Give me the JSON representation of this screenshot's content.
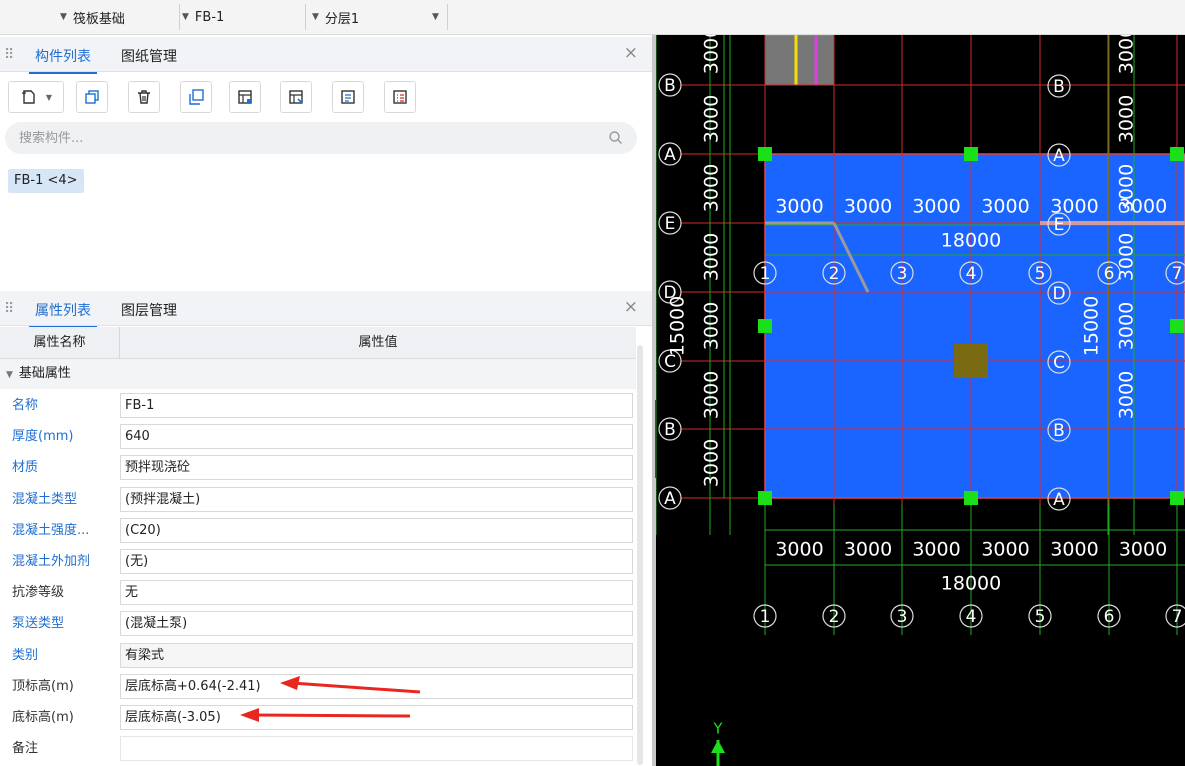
{
  "toolbar": {
    "dropdown1_value": "筏板基础",
    "dropdown2_value": "FB-1",
    "dropdown3_value": "分层1"
  },
  "component_panel": {
    "tabs": [
      "构件列表",
      "图纸管理"
    ],
    "search_placeholder": "搜索构件...",
    "items": [
      "FB-1 <4>"
    ]
  },
  "property_panel": {
    "tabs": [
      "属性列表",
      "图层管理"
    ],
    "header": {
      "name": "属性名称",
      "value": "属性值"
    },
    "group": "基础属性",
    "rows": [
      {
        "name": "名称",
        "value": "FB-1",
        "blue": true
      },
      {
        "name": "厚度(mm)",
        "value": "640",
        "blue": true
      },
      {
        "name": "材质",
        "value": "预拌现浇砼",
        "blue": true
      },
      {
        "name": "混凝土类型",
        "value": "(预拌混凝土)",
        "blue": true
      },
      {
        "name": "混凝土强度...",
        "value": "(C20)",
        "blue": true
      },
      {
        "name": "混凝土外加剂",
        "value": "(无)",
        "blue": true
      },
      {
        "name": "抗渗等级",
        "value": "无",
        "blue": false
      },
      {
        "name": "泵送类型",
        "value": "(混凝土泵)",
        "blue": true
      },
      {
        "name": "类别",
        "value": "有梁式",
        "blue": true
      },
      {
        "name": "顶标高(m)",
        "value": "层底标高+0.64(-2.41)",
        "blue": false
      },
      {
        "name": "底标高(m)",
        "value": "层底标高(-3.05)",
        "blue": false
      },
      {
        "name": "备注",
        "value": "",
        "blue": false
      }
    ]
  },
  "drawing": {
    "axis_labels_top": [
      "1",
      "2",
      "3",
      "4",
      "5",
      "6",
      "7"
    ],
    "axis_labels_bottom": [
      "1",
      "2",
      "3",
      "4",
      "5",
      "6",
      "7"
    ],
    "row_labels_left": [
      "B",
      "A",
      "E",
      "D",
      "C",
      "B",
      "A"
    ],
    "row_labels_right": [
      "B",
      "A",
      "E",
      "D",
      "C",
      "B",
      "A"
    ],
    "spans_top": [
      "3000",
      "3000",
      "3000",
      "3000",
      "3000",
      "3000"
    ],
    "total_top": "18000",
    "spans_bottom": [
      "3000",
      "3000",
      "3000",
      "3000",
      "3000",
      "3000"
    ],
    "total_bottom": "18000",
    "vertical_spans_left": [
      "3000",
      "3000",
      "3000",
      "3000",
      "3000",
      "3000",
      "3000"
    ],
    "vertical_total_left": "15000",
    "vertical_spans_right": [
      "3000",
      "3000",
      "3000",
      "3000",
      "3000",
      "3000"
    ],
    "vertical_total_right": "15000",
    "y_axis_label": "Y",
    "colors": {
      "slab": "#1a64ff",
      "grid": "#22aa22",
      "axis": "#d12b2b",
      "handle": "#19e019",
      "annotation_arrow": "#e8271f"
    }
  }
}
